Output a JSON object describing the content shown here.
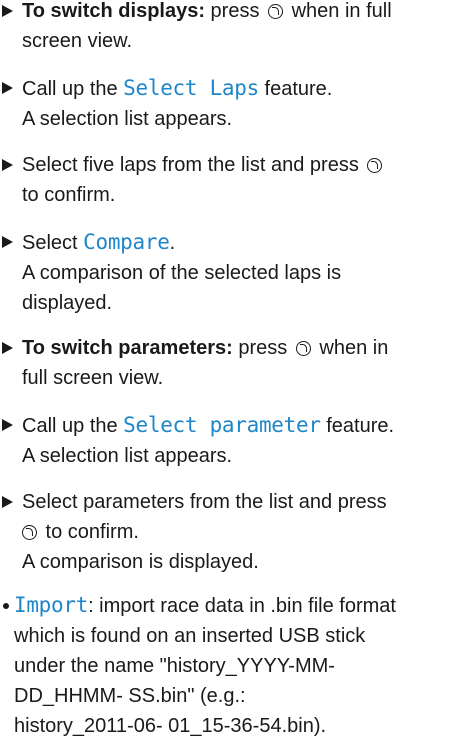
{
  "steps": [
    {
      "bold": "To switch displays:",
      "before_ctl": " press ",
      "after_ctl": " when in full",
      "line2": "screen view."
    },
    {
      "before": "Call up the ",
      "ui": "Select Laps",
      "after": " feature.",
      "line2": "A selection list appears."
    },
    {
      "line1_before_ctl": "Select five laps from the list and press ",
      "line2": "to confirm."
    },
    {
      "before": "Select ",
      "ui": "Compare",
      "after": ".",
      "line2": "A comparison of the selected laps is",
      "line3": "displayed."
    },
    {
      "bold": "To switch parameters:",
      "before_ctl": " press ",
      "after_ctl": " when in",
      "line2": "full screen view."
    },
    {
      "before": "Call up the ",
      "ui": "Select parameter",
      "after": " feature.",
      "line2": "A selection list appears."
    },
    {
      "line1": "Select parameters from the list and press",
      "line2_after_ctl": " to confirm.",
      "line3": "A comparison is displayed."
    }
  ],
  "bullet": {
    "ui": "Import",
    "line1_after": ": import race data in .bin file format",
    "line2": "which is found on an inserted USB stick",
    "line3": "under the name \"history_YYYY-MM-",
    "line4": "DD_HHMM- SS.bin\" (e.g.:",
    "line5": "history_2011-06- 01_15-36-54.bin)."
  },
  "icons": {
    "arrow": "triangle-right-icon",
    "controller": "rotary-controller-press-icon"
  },
  "colors": {
    "ui_text": "#1f86c9",
    "body_text": "#1a1a1a"
  }
}
